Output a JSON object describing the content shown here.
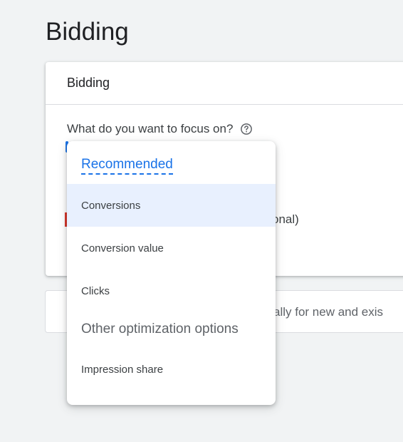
{
  "page": {
    "title": "Bidding"
  },
  "card": {
    "header_title": "Bidding",
    "focus_label": "What do you want to focus on?",
    "partial_text": "onal)"
  },
  "card2": {
    "partial_text": "ally for new and exis"
  },
  "dropdown": {
    "recommended_header": "Recommended",
    "other_header": "Other optimization options",
    "items": [
      {
        "label": "Conversions",
        "selected": true
      },
      {
        "label": "Conversion value",
        "selected": false
      },
      {
        "label": "Clicks",
        "selected": false
      },
      {
        "label": "Impression share",
        "selected": false
      }
    ]
  },
  "colors": {
    "accent": "#1a73e8",
    "selected_bg": "#e8f0fe",
    "page_bg": "#f1f3f4",
    "error_mark": "#d93025"
  },
  "icons": {
    "help": "help-circle-icon"
  }
}
